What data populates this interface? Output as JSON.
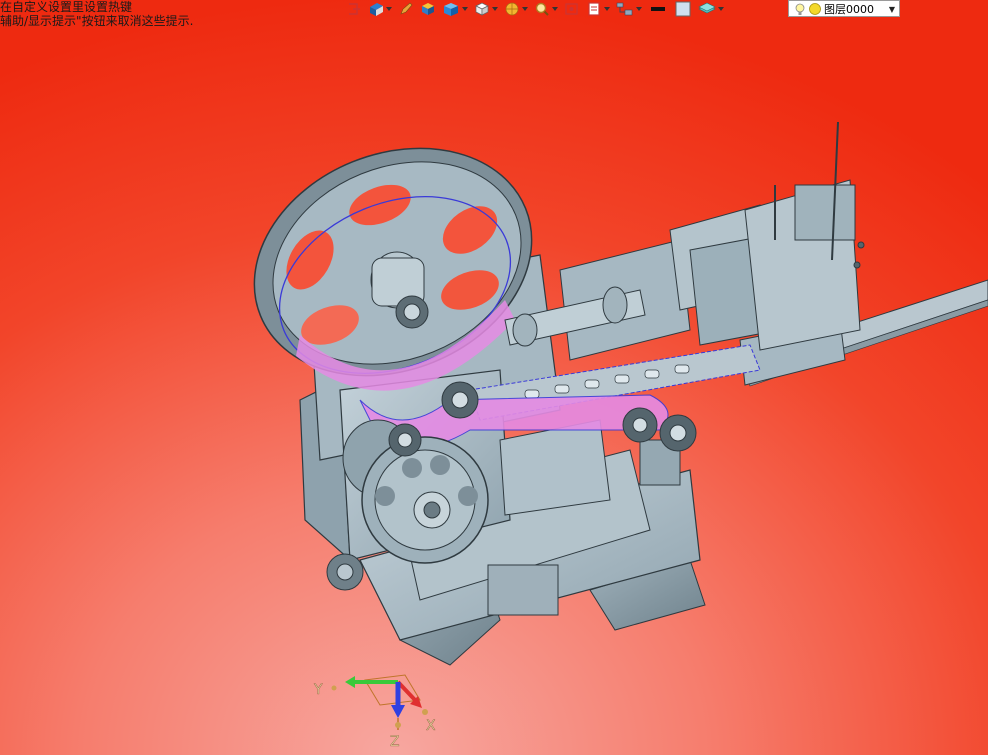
{
  "hints": {
    "line1": "在自定义设置里设置热键",
    "line2": "辅助/显示提示\"按钮来取消这些提示."
  },
  "toolbar": {
    "items": [
      {
        "icon": "snap-icon"
      },
      {
        "icon": "view-orient-icon"
      },
      {
        "icon": "pencil-icon"
      },
      {
        "icon": "solid-box-icon"
      },
      {
        "icon": "wire-box-icon"
      },
      {
        "icon": "render-icon"
      },
      {
        "icon": "zoom-icon"
      },
      {
        "icon": "section-icon"
      },
      {
        "icon": "filter-icon"
      },
      {
        "icon": "tree-icon"
      },
      {
        "icon": "line-color-icon"
      },
      {
        "icon": "face-color-icon"
      },
      {
        "icon": "layer-stack-icon"
      }
    ],
    "layer": {
      "value": "图层0000"
    }
  },
  "triad": {
    "x_label": "X",
    "y_label": "Y",
    "z_label": "Z"
  },
  "colors": {
    "part": "#a9bcc6",
    "highlight": "#e58be4",
    "edge": "#2f3a40",
    "selection": "#3a3ad8"
  }
}
